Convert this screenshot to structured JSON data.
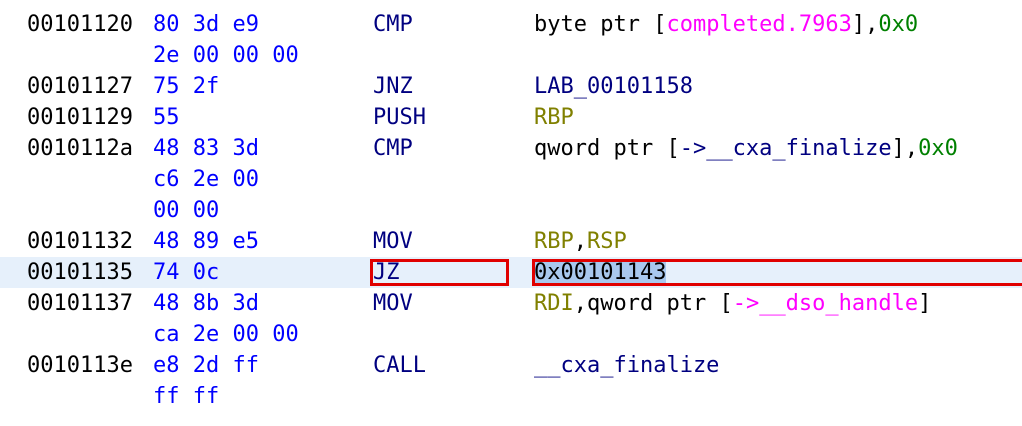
{
  "listing": [
    {
      "address": "00101120",
      "bytes": [
        "80 3d e9",
        "2e 00 00 00"
      ],
      "mnemonic": "CMP",
      "operand_parts": [
        {
          "text": "byte ptr [",
          "kind": "plain"
        },
        {
          "text": "completed.7963",
          "kind": "sym"
        },
        {
          "text": "],",
          "kind": "plain"
        },
        {
          "text": "0x0",
          "kind": "num"
        }
      ]
    },
    {
      "address": "00101127",
      "bytes": [
        "75 2f"
      ],
      "mnemonic": "JNZ",
      "operand_parts": [
        {
          "text": "LAB_00101158",
          "kind": "lbl"
        }
      ]
    },
    {
      "address": "00101129",
      "bytes": [
        "55"
      ],
      "mnemonic": "PUSH",
      "operand_parts": [
        {
          "text": "RBP",
          "kind": "reg"
        }
      ]
    },
    {
      "address": "0010112a",
      "bytes": [
        "48 83 3d",
        "c6 2e 00",
        "00 00"
      ],
      "mnemonic": "CMP",
      "operand_parts": [
        {
          "text": "qword ptr [",
          "kind": "plain"
        },
        {
          "text": "->__cxa_finalize",
          "kind": "lbl"
        },
        {
          "text": "],",
          "kind": "plain"
        },
        {
          "text": "0x0",
          "kind": "num"
        }
      ]
    },
    {
      "address": "00101132",
      "bytes": [
        "48 89 e5"
      ],
      "mnemonic": "MOV",
      "operand_parts": [
        {
          "text": "RBP",
          "kind": "reg"
        },
        {
          "text": ",",
          "kind": "plain"
        },
        {
          "text": "RSP",
          "kind": "reg"
        }
      ]
    },
    {
      "address": "00101135",
      "bytes": [
        "74 0c"
      ],
      "mnemonic": "JZ",
      "selected": true,
      "operand_parts": [
        {
          "text": "0x00101143",
          "kind": "sel"
        }
      ]
    },
    {
      "address": "00101137",
      "bytes": [
        "48 8b 3d",
        "ca 2e 00 00"
      ],
      "mnemonic": "MOV",
      "operand_parts": [
        {
          "text": "RDI",
          "kind": "reg"
        },
        {
          "text": ",qword ptr [",
          "kind": "plain"
        },
        {
          "text": "->__dso_handle",
          "kind": "sym"
        },
        {
          "text": "]",
          "kind": "plain"
        }
      ]
    },
    {
      "address": "0010113e",
      "bytes": [
        "e8 2d ff",
        "ff ff"
      ],
      "mnemonic": "CALL",
      "operand_parts": [
        {
          "text": "__cxa_finalize",
          "kind": "lbl"
        }
      ]
    }
  ],
  "colors": {
    "address": "#000000",
    "bytes": "#0000ff",
    "mnemonic": "#000080",
    "register": "#808000",
    "symbol": "#ff00ff",
    "number": "#008000",
    "selected_row": "#e6f0fb",
    "selected_text": "#a9c8ee",
    "highlight_box": "#e00000"
  }
}
